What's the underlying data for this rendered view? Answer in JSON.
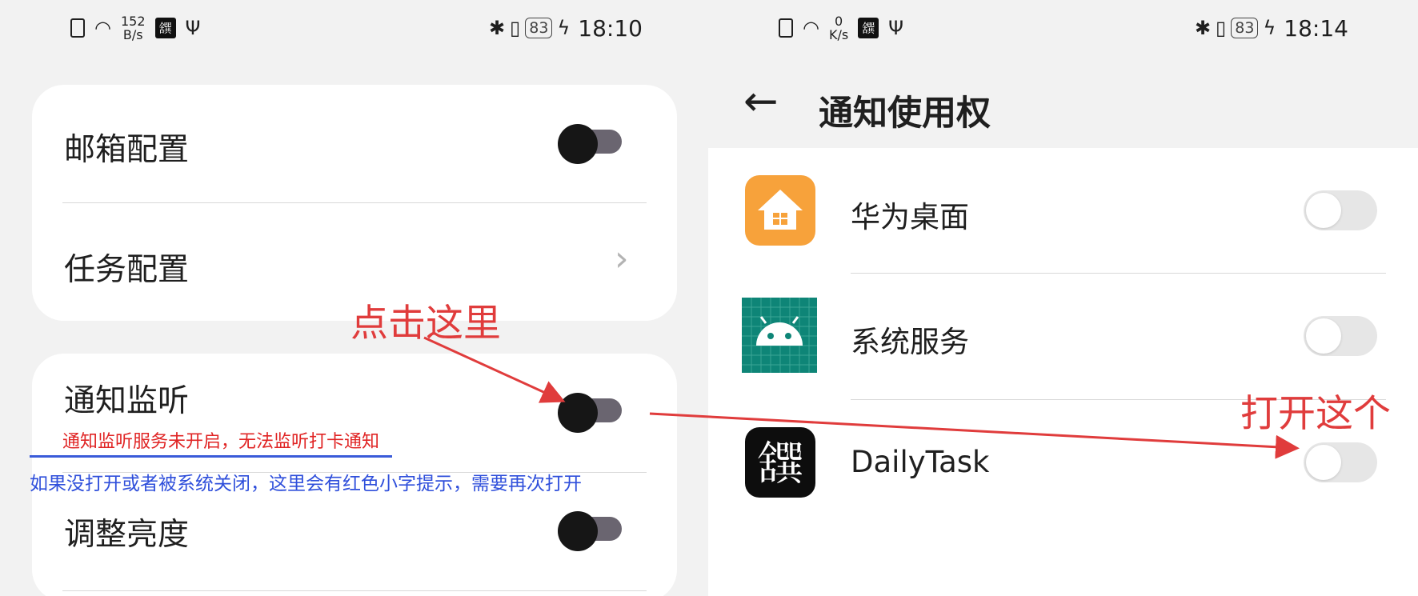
{
  "left": {
    "status_bar": {
      "speed_value": "152",
      "speed_unit": "B/s",
      "app_glyph": "𦧸",
      "battery": "83",
      "time": "18:10"
    },
    "card1": {
      "mail_config_label": "邮箱配置",
      "mail_config_on": true,
      "task_config_label": "任务配置",
      "task_chevron": "›"
    },
    "card2": {
      "notify_listen_label": "通知监听",
      "notify_listen_on": true,
      "warning": "通知监听服务未开启，无法监听打卡通知",
      "brightness_label": "调整亮度",
      "brightness_on": true
    },
    "blue_note": "如果没打开或者被系统关闭，这里会有红色小字提示，需要再次打开",
    "annotation": "点击这里"
  },
  "right": {
    "status_bar": {
      "speed_value": "0",
      "speed_unit": "K/s",
      "app_glyph": "𦧸",
      "battery": "83",
      "time": "18:14"
    },
    "back_glyph": "←",
    "title": "通知使用权",
    "apps": [
      {
        "label": "华为桌面",
        "icon": "huawei-home-icon",
        "enabled": false
      },
      {
        "label": "系统服务",
        "icon": "android-icon",
        "enabled": false
      },
      {
        "label": "DailyTask",
        "icon": "dailytask-icon",
        "glyph": "𦧸",
        "enabled": false
      }
    ],
    "annotation": "打开这个"
  },
  "colors": {
    "annotation_red": "#e03c3c",
    "note_blue": "#2f4fdb",
    "huawei_orange": "#f7a23b",
    "android_teal": "#0e8577"
  }
}
